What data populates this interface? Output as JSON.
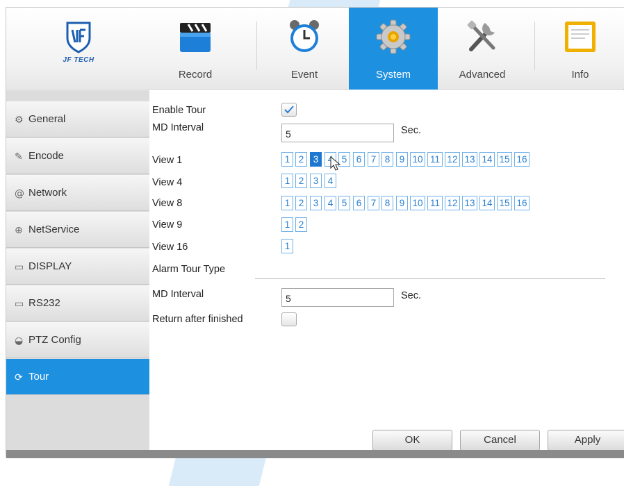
{
  "logo": {
    "text": "JF TECH"
  },
  "nav": {
    "tabs": [
      {
        "label": "Record",
        "icon": "clapperboard-icon"
      },
      {
        "label": "Event",
        "icon": "alarm-clock-icon"
      },
      {
        "label": "System",
        "icon": "gear-icon",
        "active": true
      },
      {
        "label": "Advanced",
        "icon": "tools-icon"
      },
      {
        "label": "Info",
        "icon": "info-board-icon"
      }
    ]
  },
  "sidebar": {
    "items": [
      {
        "label": "General",
        "icon": "gear-icon",
        "glyph": "⚙"
      },
      {
        "label": "Encode",
        "icon": "edit-icon",
        "glyph": "✎"
      },
      {
        "label": "Network",
        "icon": "at-icon",
        "glyph": "@"
      },
      {
        "label": "NetService",
        "icon": "globe-icon",
        "glyph": "⊕"
      },
      {
        "label": "DISPLAY",
        "icon": "monitor-icon",
        "glyph": "▭"
      },
      {
        "label": "RS232",
        "icon": "serial-icon",
        "glyph": "▭"
      },
      {
        "label": "PTZ Config",
        "icon": "ptz-icon",
        "glyph": "◒"
      },
      {
        "label": "Tour",
        "icon": "refresh-icon",
        "glyph": "⟳",
        "active": true
      }
    ]
  },
  "form": {
    "enable_tour_label": "Enable Tour",
    "enable_tour_checked": true,
    "md_interval_label": "MD Interval",
    "md_interval_value": "5",
    "md_interval_unit": "Sec.",
    "views": [
      {
        "label": "View 1",
        "buttons": [
          "1",
          "2",
          "3",
          "4",
          "5",
          "6",
          "7",
          "8",
          "9",
          "10",
          "11",
          "12",
          "13",
          "14",
          "15",
          "16"
        ],
        "selected": "3"
      },
      {
        "label": "View 4",
        "buttons": [
          "1",
          "2",
          "3",
          "4"
        ]
      },
      {
        "label": "View 8",
        "buttons": [
          "1",
          "2",
          "3",
          "4",
          "5",
          "6",
          "7",
          "8",
          "9",
          "10",
          "11",
          "12",
          "13",
          "14",
          "15",
          "16"
        ]
      },
      {
        "label": "View 9",
        "buttons": [
          "1",
          "2"
        ]
      },
      {
        "label": "View 16",
        "buttons": [
          "1"
        ]
      }
    ],
    "alarm_tour_type_label": "Alarm Tour Type",
    "alarm_md_interval_label": "MD Interval",
    "alarm_md_interval_value": "5",
    "alarm_md_interval_unit": "Sec.",
    "return_after_finished_label": "Return after finished",
    "return_after_finished_checked": false
  },
  "buttons": {
    "ok": "OK",
    "cancel": "Cancel",
    "apply": "Apply"
  },
  "colors": {
    "accent": "#1e90e0",
    "selected_number": "#1e78d2"
  }
}
